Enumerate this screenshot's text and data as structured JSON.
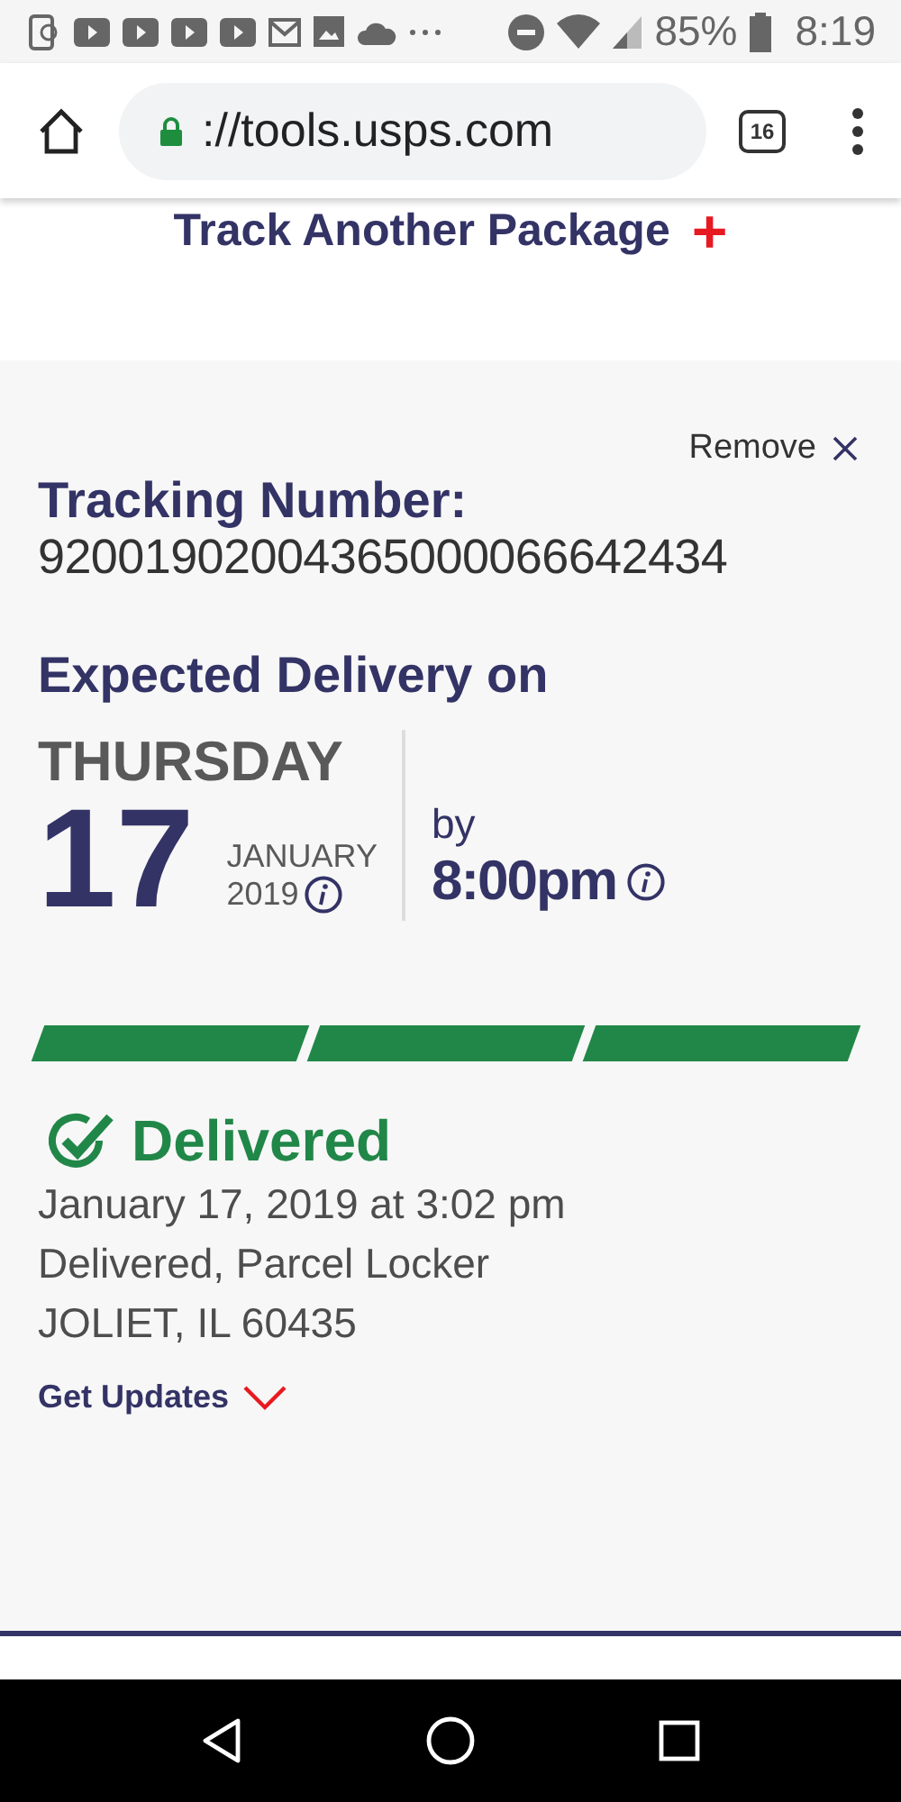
{
  "status_bar": {
    "battery": "85%",
    "time": "8:19"
  },
  "browser": {
    "url": "://tools.usps.com",
    "tab_count": "16"
  },
  "track_another": {
    "label": "Track Another Package",
    "icon": "+"
  },
  "tracking": {
    "remove": "Remove",
    "heading": "Tracking Number:",
    "number": "92001902004365000066642434"
  },
  "expected": {
    "heading": "Expected Delivery on",
    "weekday": "THURSDAY",
    "day": "17",
    "month": "JANUARY",
    "year": "2019",
    "by": "by",
    "time": "8:00pm"
  },
  "progress": [
    {
      "filled": true
    },
    {
      "filled": true
    },
    {
      "filled": true
    }
  ],
  "status": {
    "title": "Delivered",
    "lines": [
      "January 17, 2019 at 3:02 pm",
      "Delivered, Parcel Locker",
      "JOLIET, IL 60435"
    ],
    "get_updates": "Get Updates"
  }
}
